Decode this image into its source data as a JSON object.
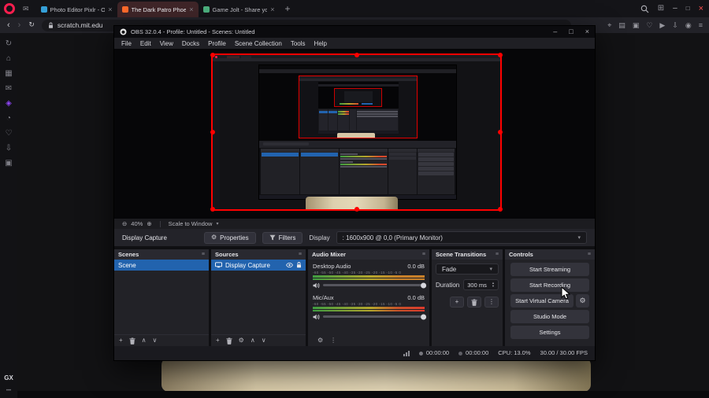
{
  "colors": {
    "opera_accent": "#fa1e4e",
    "active_tab_bg": "#3f2528",
    "selection_blue": "#2263ae",
    "capture_border": "#ff0000",
    "meter_green": "#3f9d41",
    "meter_yellow": "#b5a62c",
    "meter_red": "#df3a2c",
    "beige_shape": "#dccfae",
    "twitch_purple": "#9146ff"
  },
  "browser": {
    "tabs": [
      {
        "title": "Photo Editor Pixlr - Outl...",
        "favicon_color": "#35a0d8"
      },
      {
        "title": "The Dark Patro Phoenix O...",
        "favicon_color": "#ff6a2b"
      },
      {
        "title": "Game Jolt - Share your cr...",
        "favicon_color": "#4caf7d"
      }
    ],
    "glyphs": {
      "new_tab": "+",
      "close_tab": "×",
      "back": "‹",
      "forward": "›",
      "reload": "↻",
      "minimize": "–",
      "maximize": "□",
      "close_window": "×",
      "tab_tiling": "⊞"
    },
    "address": {
      "url": "scratch.mit.edu"
    },
    "actions": [
      {
        "name": "snapshot",
        "glyph": "⌖"
      },
      {
        "name": "reading-list",
        "glyph": "▤"
      },
      {
        "name": "extensions",
        "glyph": "▣"
      },
      {
        "name": "pinboards",
        "glyph": "♡"
      },
      {
        "name": "player",
        "glyph": "▶"
      },
      {
        "name": "downloads",
        "glyph": "⇩"
      },
      {
        "name": "profile",
        "glyph": "◉"
      },
      {
        "name": "menu",
        "glyph": "≡"
      }
    ],
    "sidebar_icons": [
      {
        "name": "gx-corner",
        "glyph": "↻"
      },
      {
        "name": "speed-dial",
        "glyph": "⌂"
      },
      {
        "name": "tab-tiling",
        "glyph": "▦"
      },
      {
        "name": "messenger",
        "glyph": "✉"
      },
      {
        "name": "twitch",
        "glyph": "◈"
      },
      {
        "name": "history",
        "glyph": "◔"
      },
      {
        "name": "pinboards",
        "glyph": "♡"
      },
      {
        "name": "downloads",
        "glyph": "⇩"
      },
      {
        "name": "extensions",
        "glyph": "▣"
      }
    ],
    "gx_footer": {
      "logo": "GX",
      "more": "•••"
    }
  },
  "obs": {
    "title": "OBS 32.0.4 - Profile: Untitled - Scenes: Untitled",
    "window_controls": {
      "minimize": "–",
      "maximize": "□",
      "close": "×"
    },
    "menu": [
      "File",
      "Edit",
      "View",
      "Docks",
      "Profile",
      "Scene Collection",
      "Tools",
      "Help"
    ],
    "preview_toolbar": {
      "zoom_out": "⊖",
      "zoom_level": "40%",
      "zoom_in": "⊕",
      "scale_mode": "Scale to Window",
      "caret": "▾"
    },
    "source_toolbar": {
      "source_name": "Display Capture",
      "properties": "Properties",
      "filters": "Filters",
      "display_label": "Display",
      "display_value": ": 1600x900 @ 0,0 (Primary Monitor)",
      "caret": "▾"
    },
    "scenes": {
      "title": "Scenes",
      "rows": [
        "Scene"
      ]
    },
    "sources": {
      "title": "Sources",
      "rows": [
        "Display Capture"
      ]
    },
    "mixer": {
      "title": "Audio Mixer",
      "scale": "-60 -55 -50 -45 -40 -35 -30 -25 -20 -15 -10 -5 0",
      "channels": [
        {
          "name": "Desktop Audio",
          "level": "0.0 dB"
        },
        {
          "name": "Mic/Aux",
          "level": "0.0 dB"
        }
      ]
    },
    "transitions": {
      "title": "Scene Transitions",
      "selected": "Fade",
      "duration_label": "Duration",
      "duration_value": "300 ms",
      "caret": "▾",
      "spin_up": "▲",
      "spin_down": "▼"
    },
    "controls": {
      "title": "Controls",
      "buttons": [
        "Start Streaming",
        "Start Recording",
        "Start Virtual Camera",
        "Studio Mode",
        "Settings"
      ]
    },
    "status_bar": {
      "rec_time": "00:00:00",
      "stream_time": "00:00:00",
      "cpu": "CPU: 13.0%",
      "fps": "30.00 / 30.00 FPS"
    },
    "glyphs": {
      "add": "+",
      "up": "∧",
      "down": "∨",
      "gear": "⚙",
      "more": "⋮",
      "dock_menu": "≡"
    }
  }
}
